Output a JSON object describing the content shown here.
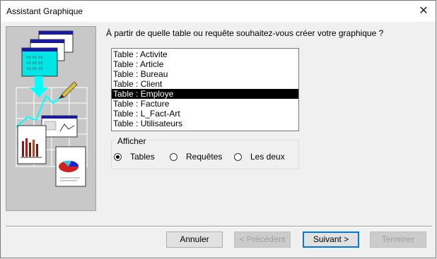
{
  "window": {
    "title": "Assistant Graphique",
    "close_glyph": "✕"
  },
  "prompt": "À partir de quelle table ou requête souhaitez-vous créer votre graphique ?",
  "list": {
    "items": [
      "Table : Activite",
      "Table : Article",
      "Table : Bureau",
      "Table : Client",
      "Table : Employe",
      "Table : Facture",
      "Table : L_Fact-Art",
      "Table : Utilisateurs"
    ],
    "selected_index": 4
  },
  "afficher": {
    "label": "Afficher",
    "options": {
      "tables": "Tables",
      "requetes": "Requêtes",
      "lesdeux": "Les deux"
    },
    "selected": "tables"
  },
  "buttons": {
    "annuler": "Annuler",
    "precedent": "< Précédent",
    "suivant": "Suivant >",
    "terminer": "Terminer"
  },
  "colors": {
    "accent": "#0078d7",
    "selection": "#000000",
    "illustration_bg": "#c8c8c8",
    "cyan": "#00ffff"
  }
}
